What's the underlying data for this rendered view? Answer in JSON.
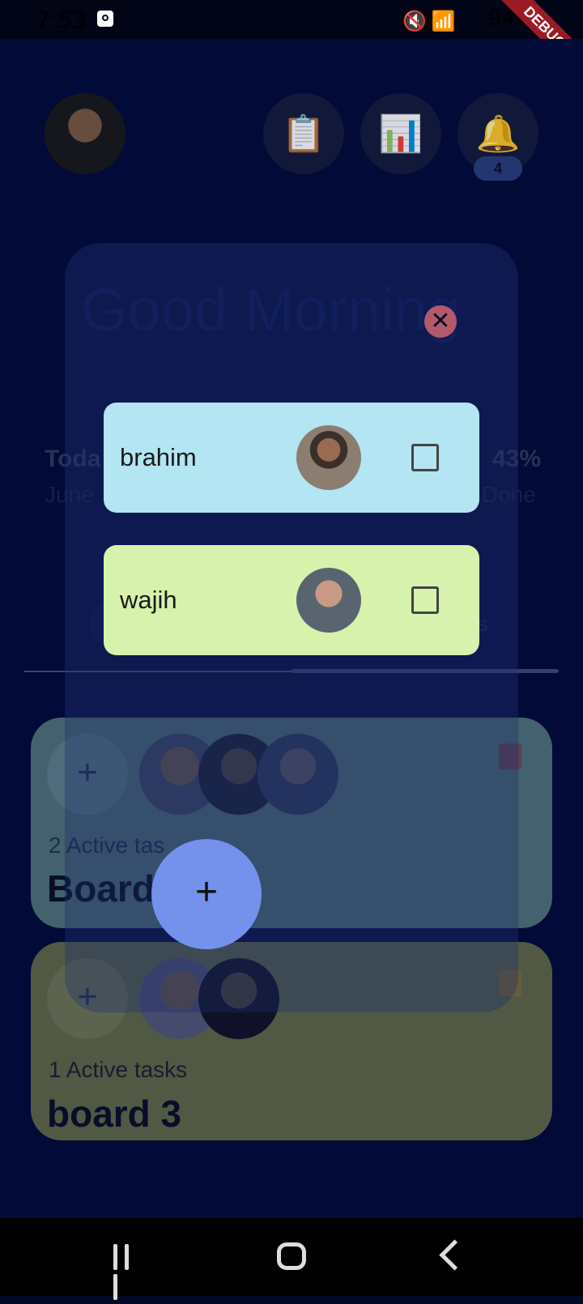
{
  "status_bar": {
    "time": "7:53",
    "battery": "94%",
    "debug_label": "DEBUG"
  },
  "header": {
    "notification_count": "4"
  },
  "background": {
    "greeting": "Good Morning",
    "today_label": "Toda",
    "date_label": "June",
    "progress_percent": "43%",
    "done_label": "Done",
    "tab_label": "ds"
  },
  "boards": [
    {
      "active_tasks": "2 Active tas",
      "name": "Board"
    },
    {
      "active_tasks": "1 Active tasks",
      "name": "board 3"
    }
  ],
  "dialog": {
    "members": [
      {
        "name": "brahim",
        "checked": false,
        "color": "#b3e5f2"
      },
      {
        "name": "wajih",
        "checked": false,
        "color": "#d6f2ad"
      }
    ],
    "close_icon": "close-icon",
    "fab_icon": "plus-icon"
  }
}
